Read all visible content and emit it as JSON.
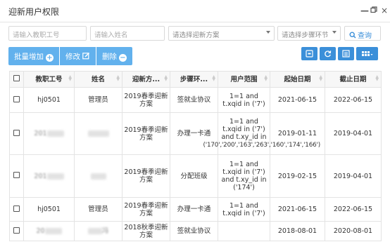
{
  "window": {
    "title": "迎新用户权限",
    "controls": {
      "minimize": "—",
      "maximize": "□",
      "close": "×"
    }
  },
  "search": {
    "staff_id_placeholder": "请输入教职工号",
    "name_placeholder": "请输入姓名",
    "plan_placeholder": "请选择迎新方案",
    "step_placeholder": "请选择步骤环节",
    "query_label": "查询"
  },
  "toolbar": {
    "batch_add_label": "批量增加",
    "edit_label": "修改",
    "delete_label": "删除",
    "right_icons": [
      "toggle-icon",
      "refresh-icon",
      "list-icon",
      "grid-menu-icon"
    ]
  },
  "table": {
    "headers": [
      "教职工号",
      "姓名",
      "迎新方...",
      "步骤环...",
      "用户范围",
      "起始日期",
      "截止日期"
    ],
    "rows": [
      {
        "staff_id": "hj0501",
        "name": "管理员",
        "plan_line1": "2019春季迎新",
        "plan_line2": "方案",
        "step": "签就业协议",
        "scope_lines": [
          "1=1 and",
          "t.xqid in ('7')"
        ],
        "start": "2021-06-15",
        "end": "2022-06-15"
      },
      {
        "staff_id": "201",
        "name": "",
        "plan_line1": "2019春季迎新",
        "plan_line2": "方案",
        "step": "办理一卡通",
        "scope_lines": [
          "1=1 and",
          "t.xqid in ('7')",
          "and t.xy_id in",
          "('170','200','163','263','160','174','166')"
        ],
        "start": "2019-01-11",
        "end": "2019-04-01"
      },
      {
        "staff_id": "201",
        "name": "",
        "plan_line1": "2019春季迎新",
        "plan_line2": "方案",
        "step": "分配班级",
        "scope_lines": [
          "1=1 and",
          "t.xqid in ('7')",
          "and t.xy_id in",
          "('174')"
        ],
        "start": "2019-02-15",
        "end": "2019-04-01"
      },
      {
        "staff_id": "hj0501",
        "name": "管理员",
        "plan_line1": "2019春季迎新",
        "plan_line2": "方案",
        "step": "办理一卡通",
        "scope_lines": [
          "1=1 and",
          "t.xqid in ('7')"
        ],
        "start": "2021-06-15",
        "end": "2022-06-15"
      },
      {
        "staff_id": "20",
        "name": "冯",
        "plan_line1": "2018秋季迎新",
        "plan_line2": "方案",
        "step": "签就业协议",
        "scope_lines": [],
        "start": "2018-08-01",
        "end": "2020-08-01"
      }
    ]
  },
  "colors": {
    "toolbar_button": "#62b1ed",
    "icon_button": "#3b8fd9",
    "query_text": "#3b8fd9"
  }
}
